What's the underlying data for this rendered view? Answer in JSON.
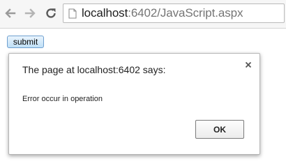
{
  "browser": {
    "address_bar": {
      "url_host": "localhost",
      "url_rest": ":6402/JavaScript.aspx"
    },
    "icons": {
      "back": "back-arrow-icon",
      "forward": "forward-arrow-icon",
      "reload": "reload-icon",
      "page": "page-icon"
    }
  },
  "page": {
    "submit_label": "submit"
  },
  "dialog": {
    "title": "The page at localhost:6402 says:",
    "message": "Error occur in operation",
    "ok_label": "OK",
    "close_icon": "close-icon"
  },
  "colors": {
    "submit_border": "#6e9fcf",
    "submit_fill": "#bfdff6"
  }
}
